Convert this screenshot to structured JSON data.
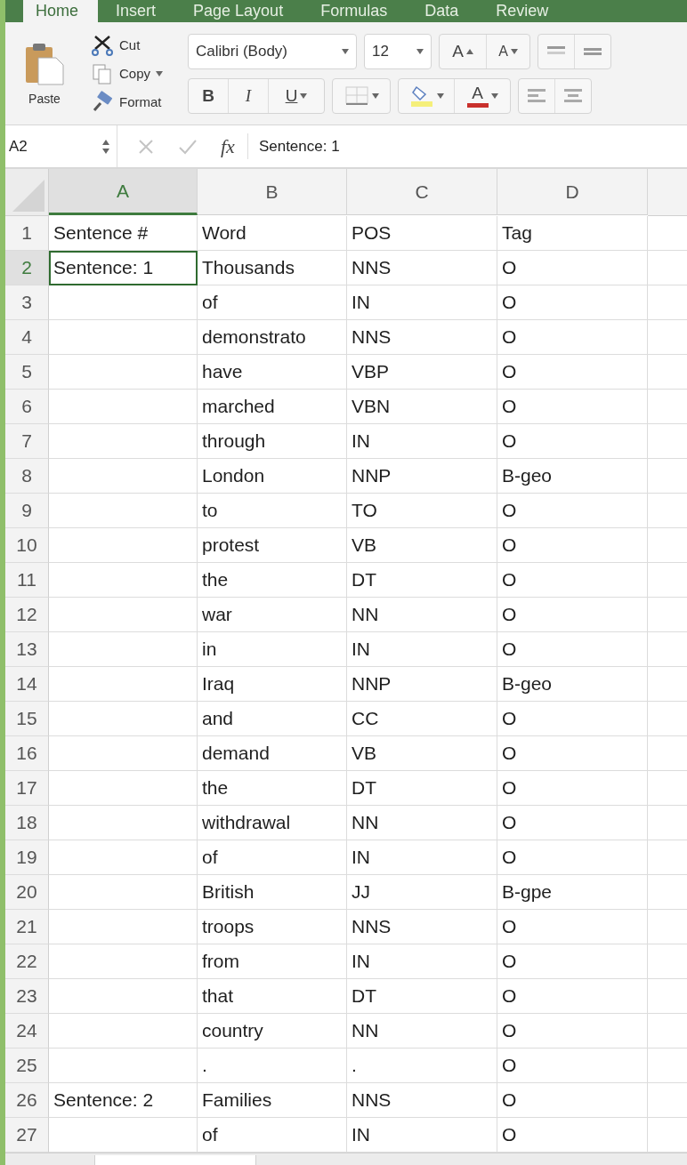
{
  "ribbon_tabs": [
    {
      "label": "Home",
      "selected": true
    },
    {
      "label": "Insert",
      "selected": false
    },
    {
      "label": "Page Layout",
      "selected": false
    },
    {
      "label": "Formulas",
      "selected": false
    },
    {
      "label": "Data",
      "selected": false
    },
    {
      "label": "Review",
      "selected": false
    }
  ],
  "clipboard": {
    "paste": "Paste",
    "cut": "Cut",
    "copy": "Copy",
    "format": "Format"
  },
  "font": {
    "name": "Calibri (Body)",
    "size": "12",
    "grow": "A",
    "shrink": "A",
    "bold": "B",
    "italic": "I",
    "underline": "U",
    "font_color": "A"
  },
  "formula_bar": {
    "name_box": "A2",
    "function_label": "fx",
    "value": "Sentence: 1"
  },
  "sheet": {
    "columns": [
      {
        "label": "A",
        "selected": true
      },
      {
        "label": "B",
        "selected": false
      },
      {
        "label": "C",
        "selected": false
      },
      {
        "label": "D",
        "selected": false
      }
    ],
    "rows": [
      {
        "number": "1",
        "cells": [
          {
            "text": "Sentence #",
            "selected": false
          },
          {
            "text": "Word",
            "selected": false
          },
          {
            "text": "POS",
            "selected": false
          },
          {
            "text": "Tag",
            "selected": false
          }
        ]
      },
      {
        "number": "2",
        "cells": [
          {
            "text": "Sentence: 1",
            "selected": true
          },
          {
            "text": "Thousands",
            "selected": false
          },
          {
            "text": "NNS",
            "selected": false
          },
          {
            "text": "O",
            "selected": false
          }
        ]
      },
      {
        "number": "3",
        "cells": [
          {
            "text": "",
            "selected": false
          },
          {
            "text": "of",
            "selected": false
          },
          {
            "text": "IN",
            "selected": false
          },
          {
            "text": "O",
            "selected": false
          }
        ]
      },
      {
        "number": "4",
        "cells": [
          {
            "text": "",
            "selected": false
          },
          {
            "text": "demonstrato",
            "selected": false
          },
          {
            "text": "NNS",
            "selected": false
          },
          {
            "text": "O",
            "selected": false
          }
        ]
      },
      {
        "number": "5",
        "cells": [
          {
            "text": "",
            "selected": false
          },
          {
            "text": "have",
            "selected": false
          },
          {
            "text": "VBP",
            "selected": false
          },
          {
            "text": "O",
            "selected": false
          }
        ]
      },
      {
        "number": "6",
        "cells": [
          {
            "text": "",
            "selected": false
          },
          {
            "text": "marched",
            "selected": false
          },
          {
            "text": "VBN",
            "selected": false
          },
          {
            "text": "O",
            "selected": false
          }
        ]
      },
      {
        "number": "7",
        "cells": [
          {
            "text": "",
            "selected": false
          },
          {
            "text": "through",
            "selected": false
          },
          {
            "text": "IN",
            "selected": false
          },
          {
            "text": "O",
            "selected": false
          }
        ]
      },
      {
        "number": "8",
        "cells": [
          {
            "text": "",
            "selected": false
          },
          {
            "text": "London",
            "selected": false
          },
          {
            "text": "NNP",
            "selected": false
          },
          {
            "text": "B-geo",
            "selected": false
          }
        ]
      },
      {
        "number": "9",
        "cells": [
          {
            "text": "",
            "selected": false
          },
          {
            "text": "to",
            "selected": false
          },
          {
            "text": "TO",
            "selected": false
          },
          {
            "text": "O",
            "selected": false
          }
        ]
      },
      {
        "number": "10",
        "cells": [
          {
            "text": "",
            "selected": false
          },
          {
            "text": "protest",
            "selected": false
          },
          {
            "text": "VB",
            "selected": false
          },
          {
            "text": "O",
            "selected": false
          }
        ]
      },
      {
        "number": "11",
        "cells": [
          {
            "text": "",
            "selected": false
          },
          {
            "text": "the",
            "selected": false
          },
          {
            "text": "DT",
            "selected": false
          },
          {
            "text": "O",
            "selected": false
          }
        ]
      },
      {
        "number": "12",
        "cells": [
          {
            "text": "",
            "selected": false
          },
          {
            "text": "war",
            "selected": false
          },
          {
            "text": "NN",
            "selected": false
          },
          {
            "text": "O",
            "selected": false
          }
        ]
      },
      {
        "number": "13",
        "cells": [
          {
            "text": "",
            "selected": false
          },
          {
            "text": "in",
            "selected": false
          },
          {
            "text": "IN",
            "selected": false
          },
          {
            "text": "O",
            "selected": false
          }
        ]
      },
      {
        "number": "14",
        "cells": [
          {
            "text": "",
            "selected": false
          },
          {
            "text": "Iraq",
            "selected": false
          },
          {
            "text": "NNP",
            "selected": false
          },
          {
            "text": "B-geo",
            "selected": false
          }
        ]
      },
      {
        "number": "15",
        "cells": [
          {
            "text": "",
            "selected": false
          },
          {
            "text": "and",
            "selected": false
          },
          {
            "text": "CC",
            "selected": false
          },
          {
            "text": "O",
            "selected": false
          }
        ]
      },
      {
        "number": "16",
        "cells": [
          {
            "text": "",
            "selected": false
          },
          {
            "text": "demand",
            "selected": false
          },
          {
            "text": "VB",
            "selected": false
          },
          {
            "text": "O",
            "selected": false
          }
        ]
      },
      {
        "number": "17",
        "cells": [
          {
            "text": "",
            "selected": false
          },
          {
            "text": "the",
            "selected": false
          },
          {
            "text": "DT",
            "selected": false
          },
          {
            "text": "O",
            "selected": false
          }
        ]
      },
      {
        "number": "18",
        "cells": [
          {
            "text": "",
            "selected": false
          },
          {
            "text": "withdrawal",
            "selected": false
          },
          {
            "text": "NN",
            "selected": false
          },
          {
            "text": "O",
            "selected": false
          }
        ]
      },
      {
        "number": "19",
        "cells": [
          {
            "text": "",
            "selected": false
          },
          {
            "text": "of",
            "selected": false
          },
          {
            "text": "IN",
            "selected": false
          },
          {
            "text": "O",
            "selected": false
          }
        ]
      },
      {
        "number": "20",
        "cells": [
          {
            "text": "",
            "selected": false
          },
          {
            "text": "British",
            "selected": false
          },
          {
            "text": "JJ",
            "selected": false
          },
          {
            "text": "B-gpe",
            "selected": false
          }
        ]
      },
      {
        "number": "21",
        "cells": [
          {
            "text": "",
            "selected": false
          },
          {
            "text": "troops",
            "selected": false
          },
          {
            "text": "NNS",
            "selected": false
          },
          {
            "text": "O",
            "selected": false
          }
        ]
      },
      {
        "number": "22",
        "cells": [
          {
            "text": "",
            "selected": false
          },
          {
            "text": "from",
            "selected": false
          },
          {
            "text": "IN",
            "selected": false
          },
          {
            "text": "O",
            "selected": false
          }
        ]
      },
      {
        "number": "23",
        "cells": [
          {
            "text": "",
            "selected": false
          },
          {
            "text": "that",
            "selected": false
          },
          {
            "text": "DT",
            "selected": false
          },
          {
            "text": "O",
            "selected": false
          }
        ]
      },
      {
        "number": "24",
        "cells": [
          {
            "text": "",
            "selected": false
          },
          {
            "text": "country",
            "selected": false
          },
          {
            "text": "NN",
            "selected": false
          },
          {
            "text": "O",
            "selected": false
          }
        ]
      },
      {
        "number": "25",
        "cells": [
          {
            "text": "",
            "selected": false
          },
          {
            "text": ".",
            "selected": false
          },
          {
            "text": ".",
            "selected": false
          },
          {
            "text": "O",
            "selected": false
          }
        ]
      },
      {
        "number": "26",
        "cells": [
          {
            "text": "Sentence: 2",
            "selected": false
          },
          {
            "text": "Families",
            "selected": false
          },
          {
            "text": "NNS",
            "selected": false
          },
          {
            "text": "O",
            "selected": false
          }
        ]
      },
      {
        "number": "27",
        "cells": [
          {
            "text": "",
            "selected": false
          },
          {
            "text": "of",
            "selected": false
          },
          {
            "text": "IN",
            "selected": false
          },
          {
            "text": "O",
            "selected": false
          }
        ]
      }
    ]
  }
}
